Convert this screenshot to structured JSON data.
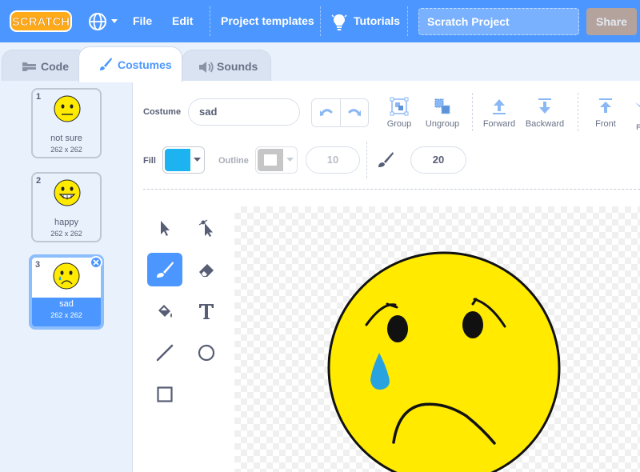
{
  "menubar": {
    "logo_text": "SCRATCH",
    "file_label": "File",
    "edit_label": "Edit",
    "templates_label": "Project templates",
    "tutorials_label": "Tutorials",
    "project_title": "Scratch Project",
    "share_label": "Share"
  },
  "tabs": [
    {
      "label": "Code",
      "icon": "code-icon"
    },
    {
      "label": "Costumes",
      "icon": "brush-icon"
    },
    {
      "label": "Sounds",
      "icon": "speaker-icon"
    }
  ],
  "costumes": [
    {
      "number": "1",
      "name": "not sure",
      "size": "262 x 262",
      "face": "neutral"
    },
    {
      "number": "2",
      "name": "happy",
      "size": "262 x 262",
      "face": "grin"
    },
    {
      "number": "3",
      "name": "sad",
      "size": "262 x 262",
      "face": "sad",
      "selected": true
    }
  ],
  "editor": {
    "costume_label": "Costume",
    "costume_name": "sad",
    "actions": {
      "group": "Group",
      "ungroup": "Ungroup",
      "forward": "Forward",
      "backward": "Backward",
      "front": "Front"
    },
    "fill_label": "Fill",
    "fill_color": "#1cb3f0",
    "outline_label": "Outline",
    "outline_width": "10",
    "brush_size": "20"
  },
  "colors": {
    "accent": "#4c97ff",
    "face": "#ffea00",
    "tear": "#29a3e0"
  }
}
